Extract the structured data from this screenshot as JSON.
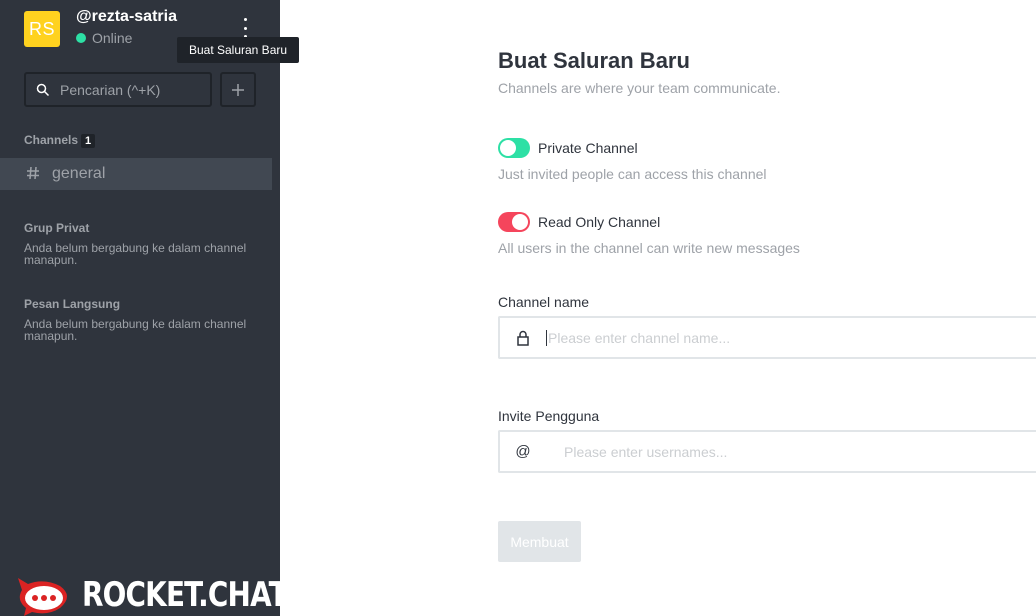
{
  "user": {
    "initials": "RS",
    "username": "@rezta-satria",
    "status": "Online"
  },
  "tooltip": "Buat Saluran Baru",
  "search": {
    "placeholder": "Pencarian (^+K)"
  },
  "sidebar": {
    "channels_title": "Channels",
    "channels_count": "1",
    "channels": [
      {
        "name": "general"
      }
    ],
    "private_title": "Grup Privat",
    "private_empty": "Anda belum bergabung ke dalam channel manapun.",
    "direct_title": "Pesan Langsung",
    "direct_empty": "Anda belum bergabung ke dalam channel manapun."
  },
  "brand": {
    "wordmark": "ROCKET.CHAT"
  },
  "form": {
    "title": "Buat Saluran Baru",
    "subtitle": "Channels are where your team communicate.",
    "private_label": "Private Channel",
    "private_hint": "Just invited people can access this channel",
    "readonly_label": "Read Only Channel",
    "readonly_hint": "All users in the channel can write new messages",
    "channel_name_label": "Channel name",
    "channel_name_placeholder": "Please enter channel name...",
    "invite_label": "Invite Pengguna",
    "invite_placeholder": "Please enter usernames...",
    "invite_icon_glyph": "@",
    "create_button": "Membuat"
  },
  "colors": {
    "sidebar_bg": "#2f343d",
    "avatar_bg": "#ffd21f",
    "online": "#2de0a5",
    "toggle_on_green": "#2de0a5",
    "toggle_on_red": "#f5455c",
    "logo_red": "#db2323"
  }
}
